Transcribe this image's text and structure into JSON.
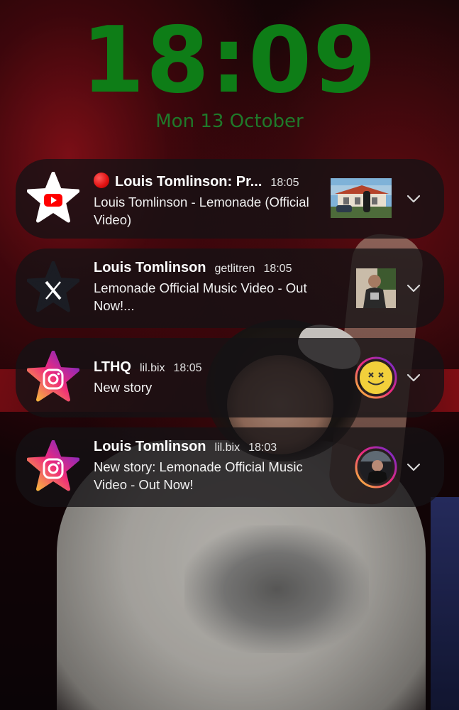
{
  "lockscreen": {
    "time": "18:09",
    "date": "Mon 13 October"
  },
  "notifications": [
    {
      "app_icon": "youtube-icon",
      "live_indicator": "red-circle-emoji",
      "title": "Louis Tomlinson: Pr...",
      "sub": "",
      "time": "18:05",
      "text": "Louis Tomlinson - Lemonade (Official Video)",
      "thumbnail": "video-thumbnail"
    },
    {
      "app_icon": "x-icon",
      "title": "Louis Tomlinson",
      "sub": "getlitren",
      "time": "18:05",
      "text": "Lemonade Official Music Video - Out Now!...",
      "thumbnail": "image-thumbnail"
    },
    {
      "app_icon": "instagram-icon",
      "title": "LTHQ",
      "sub": "lil.bix",
      "time": "18:05",
      "text": "New story",
      "thumbnail": "story-avatar"
    },
    {
      "app_icon": "instagram-icon",
      "title": "Louis Tomlinson",
      "sub": "lil.bix",
      "time": "18:03",
      "text": "New story: Lemonade Official Music Video - Out Now!",
      "thumbnail": "story-avatar"
    }
  ],
  "colors": {
    "clock": "#0e7d17",
    "date": "#1f7a2a",
    "card_bg": "rgba(20,18,20,0.78)",
    "youtube_red": "#ff0000",
    "instagram_gradient": [
      "#f9ce34",
      "#ee2a7b",
      "#6228d7"
    ]
  }
}
